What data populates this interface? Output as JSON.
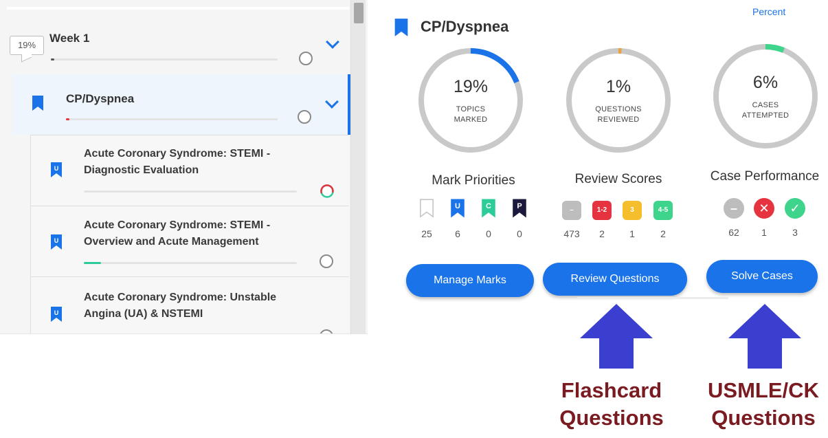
{
  "sidebar": {
    "week": {
      "badge": "19%",
      "title": "Week 1",
      "progress": 0.01
    },
    "category": {
      "title": "CP/Dyspnea",
      "progress": 0.01
    },
    "topics": [
      {
        "icon_letter": "U",
        "title_line1": "Acute Coronary Syndrome: STEMI -",
        "title_line2": "Diagnostic Evaluation",
        "progress": 0.0
      },
      {
        "icon_letter": "U",
        "title_line1": "Acute Coronary Syndrome: STEMI -",
        "title_line2": "Overview and Acute Management",
        "progress": 0.08
      },
      {
        "icon_letter": "U",
        "title_line1": "Acute Coronary Syndrome: Unstable",
        "title_line2": "Angina (UA) & NSTEMI",
        "progress": 0.0
      }
    ]
  },
  "panel": {
    "title": "CP/Dyspnea",
    "percent_link": "Percent",
    "stats": [
      {
        "value": "19%",
        "label_line1": "TOPICS",
        "label_line2": "MARKED",
        "fraction": 0.19
      },
      {
        "value": "1%",
        "label_line1": "QUESTIONS",
        "label_line2": "REVIEWED",
        "fraction": 0.01
      },
      {
        "value": "6%",
        "label_line1": "CASES",
        "label_line2": "ATTEMPTED",
        "fraction": 0.06
      }
    ],
    "mark_priorities": {
      "title": "Mark Priorities",
      "items": [
        {
          "letter": "",
          "count": "25",
          "color": "#ffffff"
        },
        {
          "letter": "U",
          "count": "6",
          "color": "#1a73e8"
        },
        {
          "letter": "C",
          "count": "0",
          "color": "#2ccb9a"
        },
        {
          "letter": "P",
          "count": "0",
          "color": "#1b1a3d"
        }
      ],
      "button": "Manage Marks"
    },
    "review_scores": {
      "title": "Review Scores",
      "items": [
        {
          "label": "–",
          "count": "473",
          "color": "#bdbdbd"
        },
        {
          "label": "1-2",
          "count": "2",
          "color": "#e53340"
        },
        {
          "label": "3",
          "count": "1",
          "color": "#f4be2c"
        },
        {
          "label": "4-5",
          "count": "2",
          "color": "#3fd48b"
        }
      ],
      "button": "Review Questions"
    },
    "case_performance": {
      "title": "Case Performance",
      "items": [
        {
          "label": "–",
          "count": "62",
          "color": "#bdbdbd"
        },
        {
          "label": "✕",
          "count": "1",
          "color": "#e53340"
        },
        {
          "label": "✓",
          "count": "3",
          "color": "#3fd48b"
        }
      ],
      "button": "Solve Cases"
    }
  },
  "annotations": {
    "left": {
      "line1": "Flashcard",
      "line2": "Questions"
    },
    "right": {
      "line1": "USMLE/CK",
      "line2": "Questions"
    }
  },
  "colors": {
    "accent": "#1a73e8",
    "annotation_text": "#7a1b21",
    "arrow": "#3b3fcf"
  }
}
